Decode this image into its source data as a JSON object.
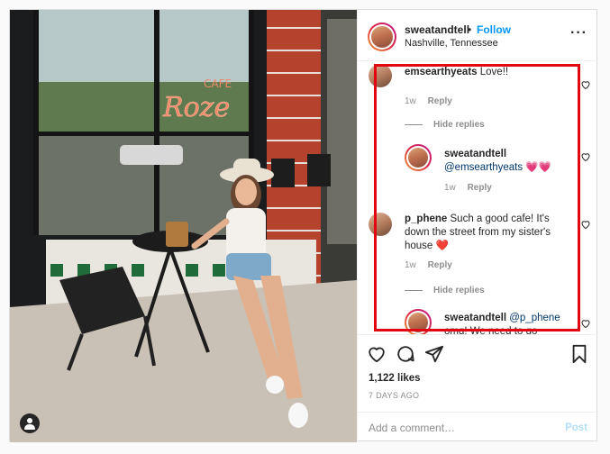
{
  "post": {
    "author": {
      "username": "sweatandtell",
      "separator": "•",
      "follow_label": "Follow",
      "location": "Nashville, Tennessee",
      "more_icon": "more-horizontal-icon"
    },
    "photo": {
      "sign_text": "Cafe Roze",
      "user_tag_icon": "user-tag-icon"
    },
    "comments": [
      {
        "username": "emsearthyeats",
        "text": "Love!!",
        "age": "1w",
        "reply_label": "Reply",
        "hide_replies_label": "Hide replies"
      },
      {
        "username": "sweatandtell",
        "mention": "@emsearthyeats",
        "text": "💗💗",
        "age": "1w",
        "reply_label": "Reply"
      },
      {
        "username": "p_phene",
        "text_line1": "Such a good cafe! It's",
        "text_line2": "down the street from my sister's",
        "text_line3": "house ❤️",
        "age": "1w",
        "reply_label": "Reply",
        "hide_replies_label": "Hide replies"
      },
      {
        "username": "sweatandtell",
        "mention": "@p_phene",
        "text_line2": "omg! We need to go"
      }
    ],
    "highlight_color": "#e20613",
    "likes": "1,122 likes",
    "date": "7 DAYS AGO",
    "add_comment": {
      "placeholder": "Add a comment…",
      "post_label": "Post"
    },
    "action_icons": [
      "heart-icon",
      "comment-icon",
      "share-icon",
      "bookmark-icon"
    ],
    "colors": {
      "link_blue": "#0095f6",
      "muted": "#8e8e8e",
      "text": "#262626"
    }
  }
}
